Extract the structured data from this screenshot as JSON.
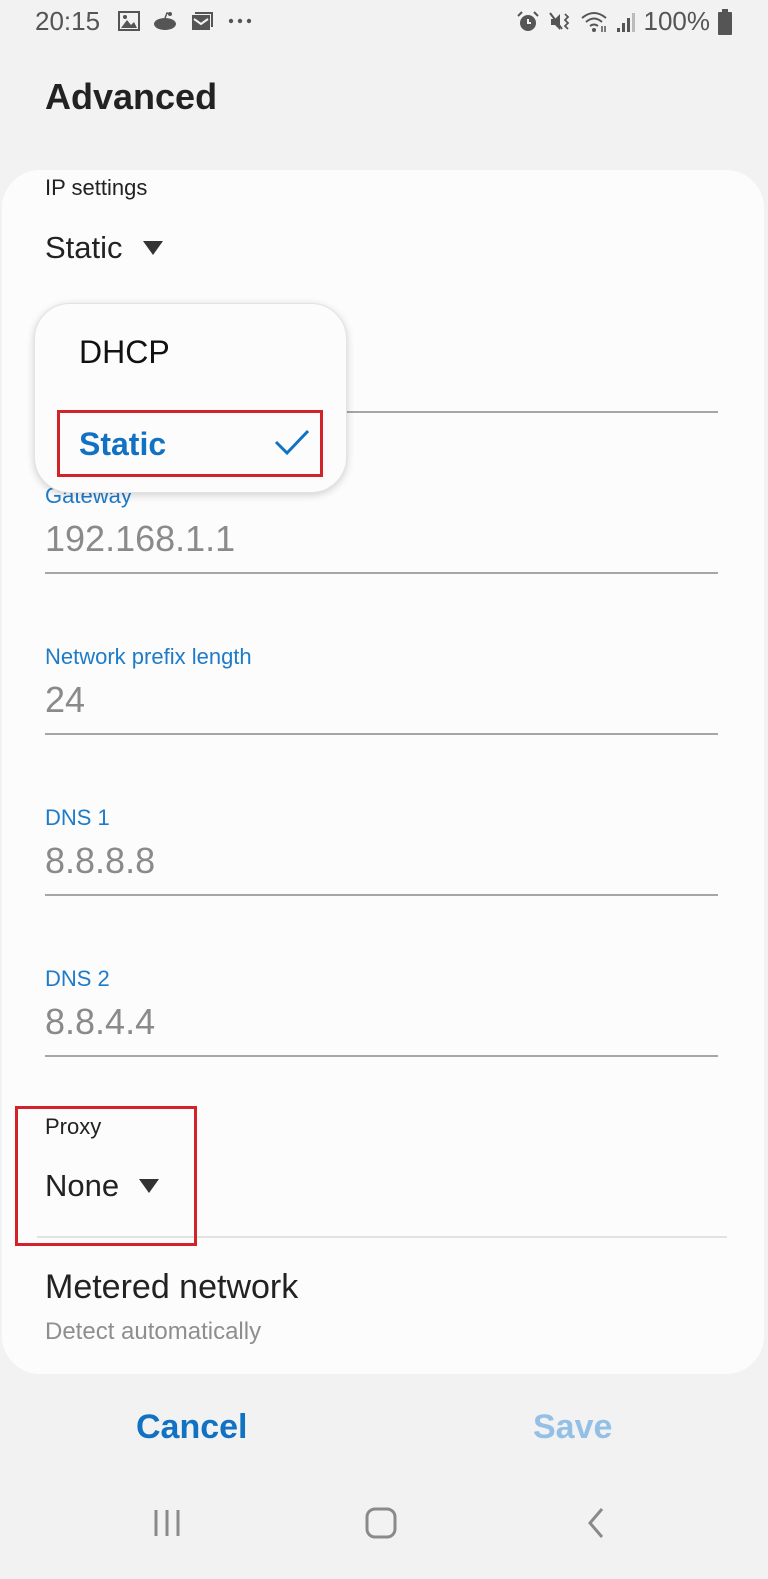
{
  "status_bar": {
    "time": "20:15",
    "left_icons": [
      "gallery-icon",
      "reddit-icon",
      "email-icon",
      "more-notifications-icon"
    ],
    "right_icons": [
      "alarm-icon",
      "mute-vibrate-icon",
      "wifi-icon",
      "signal-icon"
    ],
    "battery_percent": "100%"
  },
  "header": {
    "title": "Advanced"
  },
  "ip_settings": {
    "label": "IP settings",
    "selected": "Static",
    "options": [
      {
        "label": "DHCP",
        "selected": false
      },
      {
        "label": "Static",
        "selected": true
      }
    ]
  },
  "fields": [
    {
      "label": "Gateway",
      "value": "192.168.1.1"
    },
    {
      "label": "Network prefix length",
      "value": "24"
    },
    {
      "label": "DNS 1",
      "value": "8.8.8.8"
    },
    {
      "label": "DNS 2",
      "value": "8.8.4.4"
    }
  ],
  "proxy": {
    "label": "Proxy",
    "selected": "None"
  },
  "metered": {
    "title": "Metered network",
    "subtitle": "Detect automatically"
  },
  "actions": {
    "cancel": "Cancel",
    "save": "Save"
  },
  "colors": {
    "accent": "#1172c4",
    "accent_disabled": "#94c0e6",
    "highlight": "#d2232a"
  }
}
